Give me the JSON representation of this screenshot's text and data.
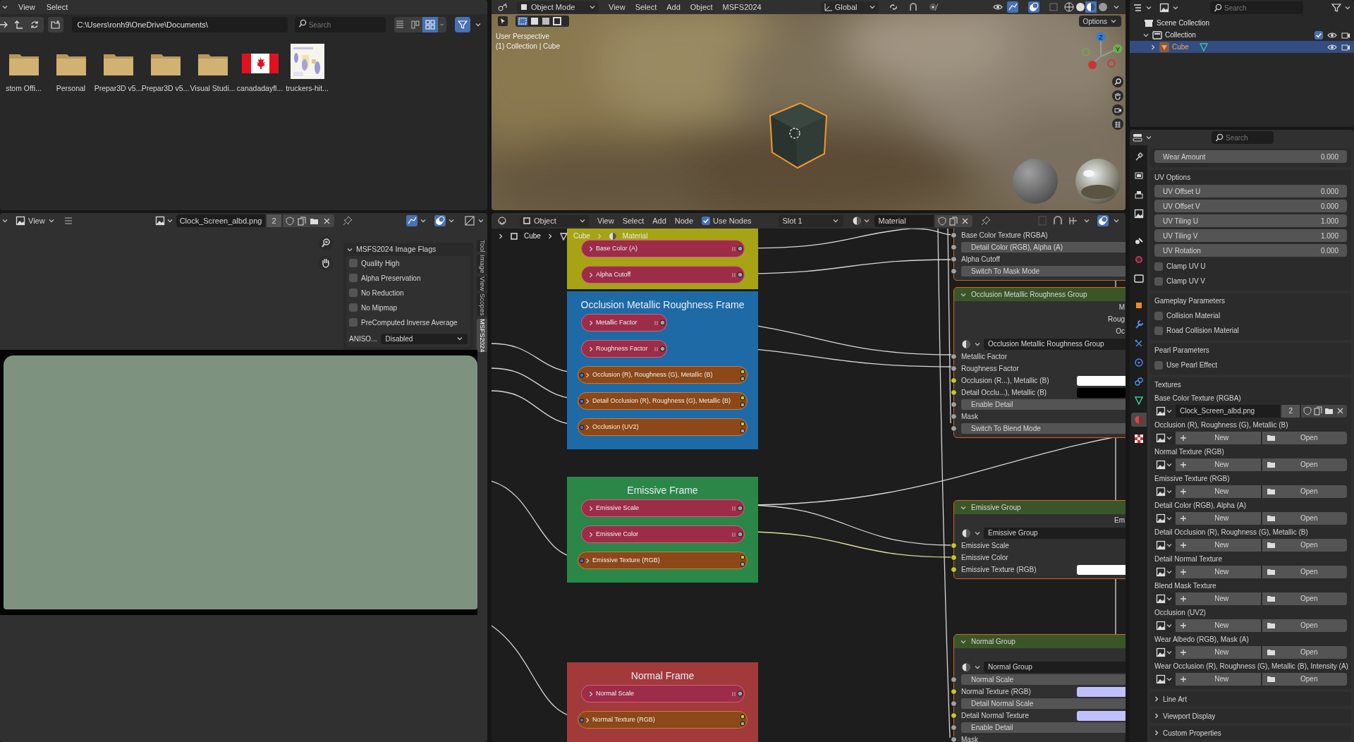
{
  "file_browser": {
    "menu": [
      "View",
      "Select"
    ],
    "path": "C:\\Users\\ronh9\\OneDrive\\Documents\\",
    "search": {
      "placeholder": "Search"
    },
    "items": [
      {
        "kind": "folder",
        "label": "stom Offi..."
      },
      {
        "kind": "folder",
        "label": "Personal"
      },
      {
        "kind": "folder",
        "label": "Prepar3D v5..."
      },
      {
        "kind": "folder",
        "label": "Prepar3D v5..."
      },
      {
        "kind": "folder",
        "label": "Visual Studi..."
      },
      {
        "kind": "flag",
        "label": "canadadayfl..."
      },
      {
        "kind": "document",
        "label": "truckers-hit..."
      }
    ]
  },
  "image_editor": {
    "menu": [
      "View"
    ],
    "image": "Clock_Screen_albd.png",
    "users": "2",
    "flags_panel": {
      "title": "MSFS2024 Image Flags",
      "flags": [
        {
          "label": "Quality High",
          "checked": false
        },
        {
          "label": "Alpha Preservation",
          "checked": false
        },
        {
          "label": "No Reduction",
          "checked": false
        },
        {
          "label": "No Mipmap",
          "checked": false
        },
        {
          "label": "PreComputed Inverse Average",
          "checked": false
        }
      ],
      "aniso": {
        "label": "ANISO...",
        "value": "Disabled"
      }
    },
    "side_tabs": [
      {
        "label": "Tool",
        "selected": false
      },
      {
        "label": "Image",
        "selected": false
      },
      {
        "label": "View",
        "selected": false
      },
      {
        "label": "Scopes",
        "selected": false
      },
      {
        "label": "MSFS2024",
        "selected": true
      }
    ]
  },
  "viewport": {
    "mode": "Object Mode",
    "menu": [
      "View",
      "Select",
      "Add",
      "Object",
      "MSFS2024"
    ],
    "orientation": "Global",
    "options": "Options",
    "info": [
      "User Perspective",
      "(1) Collection | Cube"
    ],
    "gizmo_axes": [
      "Z",
      "Y"
    ]
  },
  "node_editor": {
    "header": {
      "mode": "Object",
      "menu": [
        "View",
        "Select",
        "Add",
        "Node"
      ],
      "use_nodes": {
        "label": "Use Nodes",
        "checked": true
      },
      "slot": "Slot 1",
      "material": "Material"
    },
    "breadcrumbs": [
      "Cube",
      "Cube",
      "Material"
    ],
    "frames": [
      {
        "color": "#a6a414",
        "nodes": [
          {
            "kind": "value",
            "label": "Base Color (A)"
          },
          {
            "kind": "value",
            "label": "Alpha Cutoff"
          }
        ]
      },
      {
        "title": "Occlusion Metallic Roughness Frame",
        "color": "#1e6aa6",
        "nodes": [
          {
            "kind": "factor",
            "label": "Metallic Factor"
          },
          {
            "kind": "factor",
            "label": "Roughness Factor"
          },
          {
            "kind": "texture",
            "label": "Occlusion (R), Roughness (G), Metallic (B)"
          },
          {
            "kind": "texture",
            "label": "Detail Occlusion (R), Roughness (G), Metallic (B)"
          },
          {
            "kind": "texture",
            "label": "Occlusion (UV2)"
          }
        ]
      },
      {
        "title": "Emissive Frame",
        "color": "#2a8748",
        "nodes": [
          {
            "kind": "value",
            "label": "Emissive Scale"
          },
          {
            "kind": "value",
            "label": "Emissive Color"
          },
          {
            "kind": "texture",
            "label": "Emissive Texture (RGB)"
          }
        ]
      },
      {
        "title": "Normal Frame",
        "color": "#a2393b",
        "nodes": [
          {
            "kind": "value",
            "label": "Normal Scale"
          },
          {
            "kind": "texture",
            "label": "Normal Texture (RGB)"
          }
        ]
      }
    ],
    "group_nodes": [
      {
        "rows": [
          {
            "kind": "socket",
            "label": "Base Color Texture (RGBA)",
            "color": "#a1a1a1"
          },
          {
            "kind": "button",
            "label": "Detail Color (RGB), Alpha (A)",
            "color": "#a1a1a1"
          },
          {
            "kind": "socket",
            "label": "Alpha Cutoff",
            "color": "#a1a1a1"
          },
          {
            "kind": "button",
            "label": "Switch To Mask Mode",
            "color": "#a1a1a1"
          }
        ]
      },
      {
        "title": "Occlusion Metallic Roughness Group",
        "outputs": [
          "M",
          "Roug",
          "Oc"
        ],
        "group": "Occlusion Metallic Roughness Group",
        "rows": [
          {
            "kind": "socket",
            "label": "Metallic Factor",
            "color": "#a1a1a1"
          },
          {
            "kind": "socket",
            "label": "Roughness Factor",
            "color": "#a1a1a1"
          },
          {
            "kind": "color",
            "label": "Occlusion (R...), Metallic (B)",
            "color": "#c7c729",
            "swatch": {
              "color": "#ffffff"
            }
          },
          {
            "kind": "color",
            "label": "Detail Occlu...), Metallic (B)",
            "color": "#c7c729",
            "swatch": {
              "color": "#000000"
            }
          },
          {
            "kind": "button",
            "label": "Enable Detail",
            "color": "#a1a1a1"
          },
          {
            "kind": "socket",
            "label": "Mask",
            "color": "#a1a1a1"
          },
          {
            "kind": "button",
            "label": "Switch To Blend Mode",
            "color": "#a1a1a1"
          }
        ]
      },
      {
        "title": "Emissive Group",
        "outputs": [
          "Em"
        ],
        "group": "Emissive Group",
        "rows": [
          {
            "kind": "socket",
            "label": "Emissive Scale",
            "color": "#c7c729"
          },
          {
            "kind": "socket",
            "label": "Emissive Color",
            "color": "#c7c729"
          },
          {
            "kind": "color",
            "label": "Emissive Texture (RGB)",
            "color": "#c7c729",
            "swatch": {
              "color": "#ffffff"
            }
          }
        ]
      },
      {
        "title": "Normal Group",
        "group": "Normal Group",
        "rows": [
          {
            "kind": "button",
            "label": "Normal Scale",
            "color": "#a1a1a1"
          },
          {
            "kind": "color",
            "label": "Normal Texture (RGB)",
            "color": "#c7c729",
            "swatch": {
              "color": "#c0c0ff"
            }
          },
          {
            "kind": "button",
            "label": "Detail Normal Scale",
            "color": "#a1a1a1"
          },
          {
            "kind": "color",
            "label": "Detail Normal Texture",
            "color": "#c7c729",
            "swatch": {
              "color": "#c0c0ff"
            }
          },
          {
            "kind": "button",
            "label": "Enable Detail",
            "color": "#a1a1a1"
          },
          {
            "kind": "socket",
            "label": "Mask",
            "color": "#a1a1a1"
          }
        ]
      }
    ]
  },
  "outliner": {
    "search": {
      "placeholder": "Search"
    },
    "tree": [
      {
        "label": "Scene Collection",
        "selected": false,
        "children": [
          {
            "label": "Collection",
            "selected": false,
            "expanded": true,
            "checked": true,
            "children": [
              {
                "label": "Cube",
                "selected": true,
                "expanded": false
              }
            ]
          }
        ]
      }
    ]
  },
  "properties": {
    "search": {
      "placeholder": "Search"
    },
    "tabs": [
      {
        "selected": false
      },
      {
        "selected": false
      },
      {
        "selected": false
      },
      {
        "selected": false
      },
      {
        "selected": false
      },
      {
        "selected": false
      },
      {
        "selected": false
      },
      {
        "selected": false
      },
      {
        "selected": false
      },
      {
        "selected": false
      },
      {
        "selected": false
      },
      {
        "selected": false
      },
      {
        "selected": false
      },
      {
        "selected": true
      },
      {
        "selected": false
      }
    ],
    "sections": [
      {
        "rows": [
          {
            "kind": "number",
            "label": "Wear Amount",
            "value": "0.000"
          }
        ]
      },
      {
        "title": "UV Options",
        "rows": [
          {
            "kind": "number",
            "label": "UV Offset U",
            "value": "0.000"
          },
          {
            "kind": "number",
            "label": "UV Offset V",
            "value": "0.000"
          },
          {
            "kind": "number",
            "label": "UV Tiling U",
            "value": "1.000"
          },
          {
            "kind": "number",
            "label": "UV Tiling V",
            "value": "1.000"
          },
          {
            "kind": "number",
            "label": "UV Rotation",
            "value": "0.000"
          },
          {
            "kind": "checkbox",
            "label": "Clamp UV U",
            "checked": false
          },
          {
            "kind": "checkbox",
            "label": "Clamp UV V",
            "checked": false
          }
        ]
      },
      {
        "title": "Gameplay Parameters",
        "rows": [
          {
            "kind": "checkbox",
            "label": "Collision Material",
            "checked": false
          },
          {
            "kind": "checkbox",
            "label": "Road Collision Material",
            "checked": false
          }
        ]
      },
      {
        "title": "Pearl Parameters",
        "rows": [
          {
            "kind": "checkbox",
            "label": "Use Pearl Effect",
            "checked": false
          }
        ]
      },
      {
        "title": "Textures",
        "rows": [
          {
            "kind": "texture",
            "label": "Base Color Texture (RGBA)",
            "image": "Clock_Screen_albd.png",
            "users": "2"
          },
          {
            "kind": "texture",
            "label": "Occlusion (R), Roughness (G), Metallic (B)",
            "new": "New",
            "open": "Open"
          },
          {
            "kind": "texture",
            "label": "Normal Texture (RGB)",
            "new": "New",
            "open": "Open"
          },
          {
            "kind": "texture",
            "label": "Emissive Texture (RGB)",
            "new": "New",
            "open": "Open"
          },
          {
            "kind": "texture",
            "label": "Detail Color (RGB), Alpha (A)",
            "new": "New",
            "open": "Open"
          },
          {
            "kind": "texture",
            "label": "Detail Occlusion (R), Roughness (G), Metallic (B)",
            "new": "New",
            "open": "Open"
          },
          {
            "kind": "texture",
            "label": "Detail Normal Texture",
            "new": "New",
            "open": "Open"
          },
          {
            "kind": "texture",
            "label": "Blend Mask Texture",
            "new": "New",
            "open": "Open"
          },
          {
            "kind": "texture",
            "label": "Occlusion (UV2)",
            "new": "New",
            "open": "Open"
          },
          {
            "kind": "texture",
            "label": "Wear Albedo (RGB), Mask (A)",
            "new": "New",
            "open": "Open"
          },
          {
            "kind": "texture",
            "label": "Wear Occlusion (R), Roughness (G), Metallic (B), Intensity (A)",
            "new": "New",
            "open": "Open"
          }
        ]
      }
    ],
    "collapsed": [
      "Line Art",
      "Viewport Display",
      "Custom Properties"
    ]
  }
}
